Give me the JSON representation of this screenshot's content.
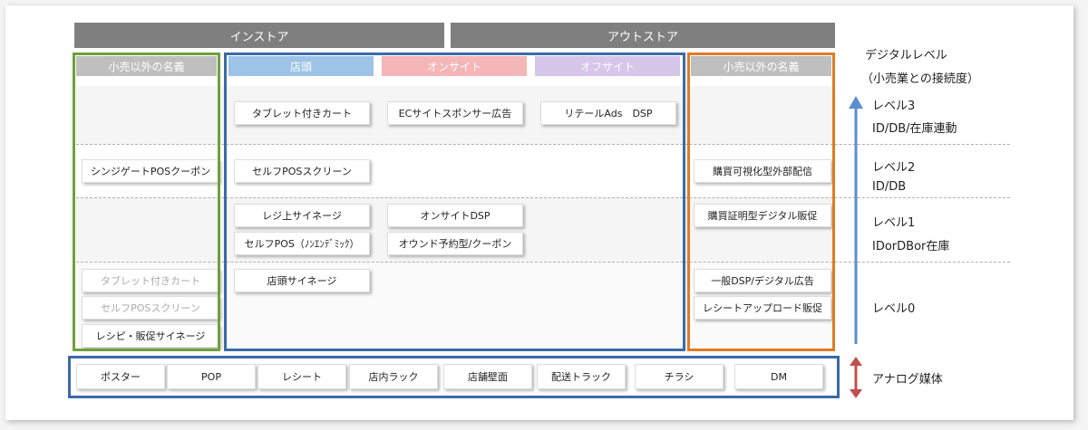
{
  "headers": {
    "instore": "インストア",
    "outstore": "アウトストア"
  },
  "subheaders": {
    "left_other": "小売以外の名義",
    "tento": "店頭",
    "onsite": "オンサイト",
    "offsite": "オフサイト",
    "right_other": "小売以外の名義"
  },
  "cards": {
    "tablet_cart": "タブレット付きカート",
    "ec_sponsor": "ECサイトスポンサー広告",
    "retail_ads": "リテールAds　DSP",
    "shinjigate": "シンジゲートPOSクーポン",
    "self_pos_screen": "セルフPOSスクリーン",
    "kobai_kashika": "購買可視化型外部配信",
    "reji_signage": "レジ上サイネージ",
    "onsite_dsp": "オンサイトDSP",
    "kobai_shomei": "購買証明型デジタル販促",
    "self_pos_non": "セルフPOS（ﾉﾝｴﾝﾃﾞﾐｯｸ）",
    "owned_coupon": "オウンド予約型/クーポン",
    "tablet_cart_faded": "タブレット付きカート",
    "tento_signage": "店頭サイネージ",
    "ippan_dsp": "一般DSP/デジタル広告",
    "self_pos_faded": "セルフPOSスクリーン",
    "receipt_upload": "レシートアップロード販促",
    "recipe_signage": "レシピ・販促サイネージ"
  },
  "media": [
    "ポスター",
    "POP",
    "レシート",
    "店内ラック",
    "店舗壁面",
    "配送トラック",
    "チラシ",
    "DM"
  ],
  "legend": {
    "title": "デジタルレベル",
    "subtitle": "（小売業との接続度）",
    "level3": "レベル3",
    "level3_desc": "ID/DB/在庫連動",
    "level2": "レベル2",
    "level2_desc": "ID/DB",
    "level1": "レベル1",
    "level1_desc": "IDorDBor在庫",
    "level0": "レベル0",
    "analog": "アナログ媒体"
  },
  "colors": {
    "header_gray": "#7f7f7f",
    "subheader_gray": "#bfbfbf",
    "tento_blue": "#9dc3e6",
    "onsite_pink": "#f4b6b6",
    "offsite_lavender": "#d5c6ea",
    "green_frame": "#70a03c",
    "blue_frame": "#3b6aa8",
    "orange_frame": "#e07b24",
    "arrow_blue": "#5b8fcf",
    "arrow_red": "#c0504d"
  }
}
